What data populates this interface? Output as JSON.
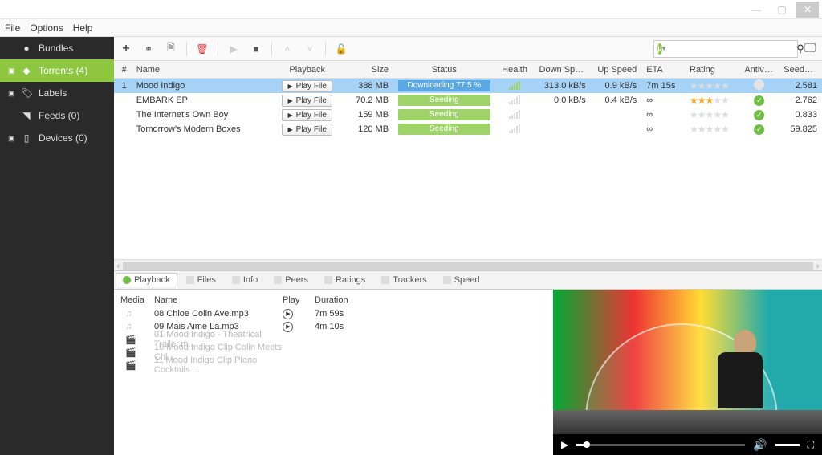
{
  "menubar": {
    "file": "File",
    "options": "Options",
    "help": "Help"
  },
  "sidebar": {
    "bundles": "Bundles",
    "torrents": "Torrents (4)",
    "labels": "Labels",
    "feeds": "Feeds (0)",
    "devices": "Devices (0)"
  },
  "columns": {
    "num": "#",
    "name": "Name",
    "playback": "Playback",
    "size": "Size",
    "status": "Status",
    "health": "Health",
    "down": "Down Speed",
    "up": "Up Speed",
    "eta": "ETA",
    "rating": "Rating",
    "antivirus": "Antivirus",
    "seeds": "Seeds/..."
  },
  "play_label": "Play File",
  "torrents": [
    {
      "num": "1",
      "name": "Mood Indigo",
      "size": "388 MB",
      "status": "Downloading 77.5 %",
      "status_kind": "dl",
      "health": "on",
      "down": "313.0 kB/s",
      "up": "0.9 kB/s",
      "eta": "7m 15s",
      "rating": 0,
      "av": "na",
      "seeds": "2.581"
    },
    {
      "num": "",
      "name": "EMBARK EP",
      "size": "70.2 MB",
      "status": "Seeding",
      "status_kind": "seed",
      "health": "off",
      "down": "0.0 kB/s",
      "up": "0.4 kB/s",
      "eta": "∞",
      "rating": 3,
      "av": "ok",
      "seeds": "2.762"
    },
    {
      "num": "",
      "name": "The Internet's Own Boy",
      "size": "159 MB",
      "status": "Seeding",
      "status_kind": "seed",
      "health": "off",
      "down": "",
      "up": "",
      "eta": "∞",
      "rating": 0,
      "av": "ok",
      "seeds": "0.833"
    },
    {
      "num": "",
      "name": "Tomorrow's Modern Boxes",
      "size": "120 MB",
      "status": "Seeding",
      "status_kind": "seed",
      "health": "off",
      "down": "",
      "up": "",
      "eta": "∞",
      "rating": 0,
      "av": "ok",
      "seeds": "59.825"
    }
  ],
  "tabs": {
    "playback": "Playback",
    "files": "Files",
    "info": "Info",
    "peers": "Peers",
    "ratings": "Ratings",
    "trackers": "Trackers",
    "speed": "Speed"
  },
  "filelist": {
    "columns": {
      "media": "Media",
      "name": "Name",
      "play": "Play",
      "duration": "Duration"
    },
    "rows": [
      {
        "kind": "audio",
        "name": "08 Chloe Colin Ave.mp3",
        "playable": true,
        "dur": "7m 59s"
      },
      {
        "kind": "audio",
        "name": "09 Mais Aime La.mp3",
        "playable": true,
        "dur": "4m 10s"
      },
      {
        "kind": "video",
        "name": "01 Mood Indigo - Theatrical Trailer.m...",
        "playable": false,
        "dur": ""
      },
      {
        "kind": "video",
        "name": "10 Mood Indigo Clip Colin Meets Chl...",
        "playable": false,
        "dur": ""
      },
      {
        "kind": "video",
        "name": "11 Mood Indigo Clip Piano Cocktails....",
        "playable": false,
        "dur": ""
      }
    ]
  }
}
